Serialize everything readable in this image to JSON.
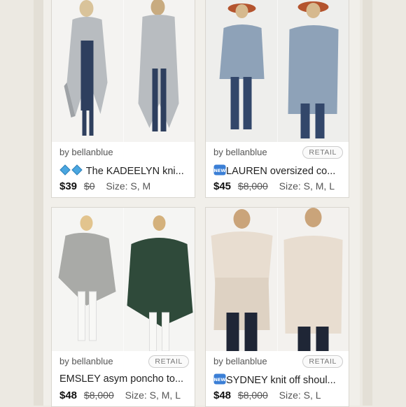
{
  "listings": [
    {
      "seller": "by bellanblue",
      "badge": "",
      "title": "The KADEELYN kni...",
      "price": "$39",
      "original_price": "$0",
      "size": "Size: S, M",
      "icon": "diamond-emoji-pair",
      "colors": {
        "garment": "#b8bcc0",
        "backdrop": "#f4f3f1",
        "pants": "#2e3f5e"
      }
    },
    {
      "seller": "by bellanblue",
      "badge": "RETAIL",
      "title": "LAUREN oversized co...",
      "price": "$45",
      "original_price": "$8,000",
      "size": "Size: S, M, L",
      "icon": "new-emoji",
      "colors": {
        "garment": "#8ea2b8",
        "backdrop": "#eeeeec",
        "pants": "#33476a",
        "hat": "#b4542e"
      }
    },
    {
      "seller": "by bellanblue",
      "badge": "RETAIL",
      "title": "EMSLEY asym poncho to...",
      "price": "$48",
      "original_price": "$8,000",
      "size": "Size: S, M, L",
      "icon": "",
      "colors": {
        "garment": "#a9aaa7",
        "garment_alt": "#2f4a3a",
        "backdrop": "#f5f5f3",
        "pants": "#f8f8f6"
      }
    },
    {
      "seller": "by bellanblue",
      "badge": "RETAIL",
      "title": "SYDNEY knit off shoul...",
      "price": "$48",
      "original_price": "$8,000",
      "size": "Size: S, L",
      "icon": "new-emoji",
      "colors": {
        "garment": "#e8ddd0",
        "backdrop": "#f3f1ee",
        "pants": "#1f2636"
      }
    }
  ]
}
